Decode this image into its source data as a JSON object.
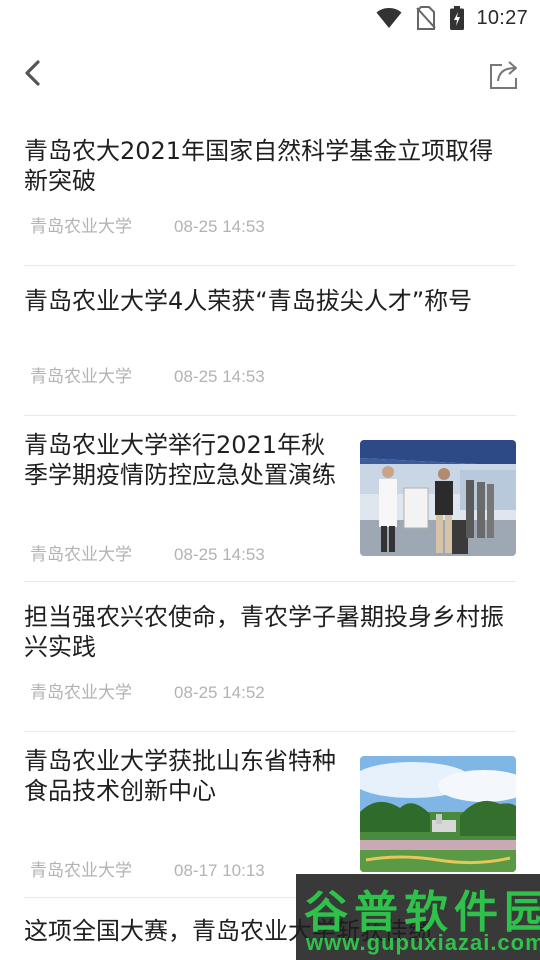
{
  "status_bar": {
    "time": "10:27",
    "icons": [
      "wifi-icon",
      "no-sim-icon",
      "battery-charging-icon"
    ]
  },
  "nav": {
    "back_icon": "chevron-left-icon",
    "share_icon": "share-icon"
  },
  "news": [
    {
      "title": "青岛农大2021年国家自然科学基金立项取得新突破",
      "source": "青岛农业大学",
      "time": "08-25 14:53",
      "has_image": false
    },
    {
      "title": "青岛农业大学4人荣获“青岛拔尖人才”称号",
      "source": "青岛农业大学",
      "time": "08-25 14:53",
      "has_image": false
    },
    {
      "title": "青岛农业大学举行2021年秋季学期疫情防控应急处置演练",
      "source": "青岛农业大学",
      "time": "08-25 14:53",
      "has_image": true,
      "image": "epidemic-drill-photo"
    },
    {
      "title": "担当强农兴农使命，青农学子暑期投身乡村振兴实践",
      "source": "青岛农业大学",
      "time": "08-25 14:52",
      "has_image": false
    },
    {
      "title": "青岛农业大学获批山东省特种食品技术创新中心",
      "source": "青岛农业大学",
      "time": "08-17 10:13",
      "has_image": true,
      "image": "campus-photo"
    }
  ],
  "partial_item": {
    "title": "这项全国大赛，青岛农业大学斩获佳绩"
  },
  "watermark": {
    "text": "谷普软件园",
    "url": "www.gupuxiazai.com"
  },
  "colors": {
    "title": "#1f1f1f",
    "meta": "#b3b3b3",
    "divider": "#e9e9e9",
    "watermark_green": "#2ec24a"
  }
}
